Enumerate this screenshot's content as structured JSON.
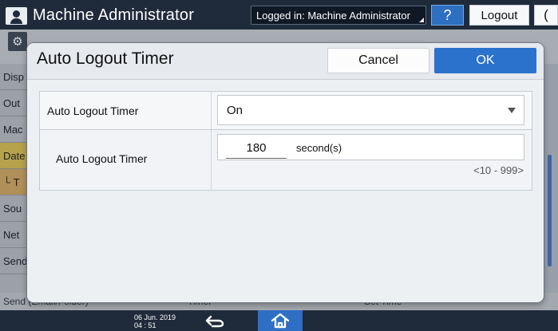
{
  "topbar": {
    "title": "Machine Administrator",
    "logged_in": "Logged in: Machine Administrator",
    "help_label": "?",
    "logout_label": "Logout",
    "moon_label": "("
  },
  "background": {
    "left_items": [
      {
        "label": "Disp"
      },
      {
        "label": "Out"
      },
      {
        "label": "Mac"
      },
      {
        "label": "Date"
      },
      {
        "label": "└ T"
      },
      {
        "label": "Sou"
      },
      {
        "label": "Net"
      },
      {
        "label": "Send (Email/Folder)"
      }
    ],
    "bottom_row": {
      "timer": "Timer",
      "set_time": "Set Time"
    }
  },
  "modal": {
    "title": "Auto Logout Timer",
    "cancel_label": "Cancel",
    "ok_label": "OK",
    "rows": [
      {
        "label": "Auto Logout Timer",
        "value": "On"
      },
      {
        "label": "Auto Logout Timer",
        "value": "180",
        "unit": "second(s)",
        "range": "<10 - 999>"
      }
    ]
  },
  "bottombar": {
    "date": "06 Jun. 2019",
    "time": "04 : 51"
  },
  "colors": {
    "accent": "#2b72cc",
    "topbar": "#1f2b3b"
  }
}
